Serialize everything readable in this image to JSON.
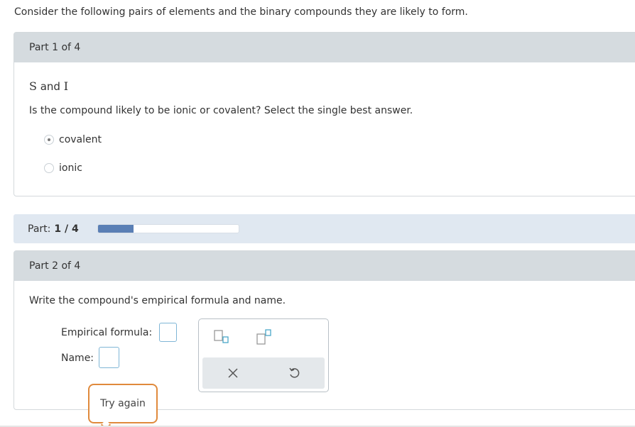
{
  "intro": "Consider the following pairs of elements and the binary compounds they are likely to form.",
  "part1": {
    "header": "Part 1 of 4",
    "element1": "S",
    "and": " and ",
    "element2": "I",
    "question": "Is the compound likely to be ionic or covalent? Select the single best answer.",
    "options": [
      {
        "label": "covalent",
        "selected": true
      },
      {
        "label": "ionic",
        "selected": false
      }
    ]
  },
  "progress": {
    "label": "Part:",
    "value": "1 / 4",
    "fraction": 0.25,
    "fill_color": "#5a7fb5"
  },
  "part2": {
    "header": "Part 2 of 4",
    "instruction": "Write the compound's empirical formula and name.",
    "formula_label": "Empirical formula:",
    "name_label": "Name:"
  },
  "palette": {
    "buttons": [
      "subscript-icon",
      "superscript-icon"
    ],
    "actions": [
      "clear-icon",
      "undo-icon"
    ]
  },
  "tooltip": {
    "text": "Try again",
    "border_color": "#e08a3c"
  }
}
